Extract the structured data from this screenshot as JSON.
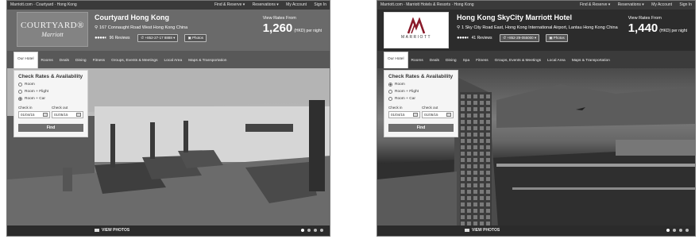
{
  "left": {
    "topbar": {
      "crumb": "Marriott.com · Courtyard · Hong Kong",
      "util": [
        "Find & Reserve ▾",
        "Reservations ▾",
        "My Account",
        "Sign In"
      ]
    },
    "logo": {
      "line1": "COURTYARD®",
      "line2": "Marriott"
    },
    "hotel": {
      "name": "Courtyard Hong Kong",
      "address": "167 Connaught Road West  Hong Kong  China",
      "reviews": "96 Reviews",
      "phone": "+852-27-17 8888",
      "photos": "Photos"
    },
    "rates": {
      "from": "View Rates From",
      "price": "1,260",
      "per": "(HKD) per night"
    },
    "nav": [
      "Our Hotel",
      "Rooms",
      "Deals",
      "Dining",
      "Fitness",
      "Groups, Events & Meetings",
      "Local Area",
      "Maps & Transportation"
    ],
    "booking": {
      "title": "Check Rates & Availability",
      "options": [
        "Room",
        "Room + Flight",
        "Room + Car"
      ],
      "selected": 2,
      "checkin_label": "Check in",
      "checkin_value": "01/04/15",
      "checkout_label": "Check out",
      "checkout_value": "01/05/15",
      "find": "Find"
    },
    "view_photos": "VIEW PHOTOS"
  },
  "right": {
    "topbar": {
      "crumb": "Marriott.com · Marriott Hotels & Resorts · Hong Kong",
      "util": [
        "Find & Reserve ▾",
        "Reservations ▾",
        "My Account",
        "Sign In"
      ]
    },
    "logo": {
      "text": "MARRIOTT"
    },
    "hotel": {
      "name": "Hong Kong SkyCity Marriott Hotel",
      "address": "1 Sky City Road East, Hong Kong International Airport, Lantau  Hong Kong  China",
      "reviews": "41 Reviews",
      "phone": "+852-29-055000",
      "photos": "Photos"
    },
    "rates": {
      "from": "View Rates From",
      "price": "1,440",
      "per": "(HKD) per night"
    },
    "nav": [
      "Our Hotel",
      "Rooms",
      "Deals",
      "Dining",
      "Spa",
      "Fitness",
      "Groups, Events & Meetings",
      "Local Area",
      "Maps & Transportation"
    ],
    "booking": {
      "title": "Check Rates & Availability",
      "options": [
        "Room",
        "Room + Flight",
        "Room + Car"
      ],
      "selected": 0,
      "checkin_label": "Check in",
      "checkin_value": "01/04/15",
      "checkout_label": "Check out",
      "checkout_value": "01/05/15",
      "find": "Find"
    },
    "view_photos": "VIEW PHOTOS"
  }
}
